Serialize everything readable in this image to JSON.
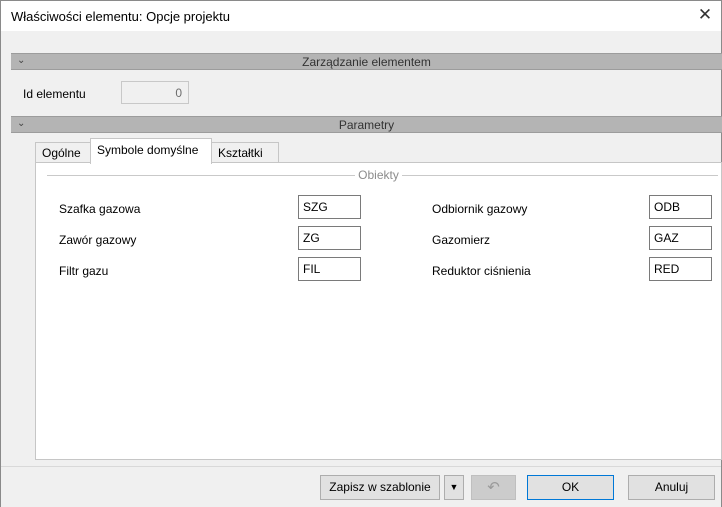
{
  "window": {
    "title": "Właściwości elementu: Opcje projektu",
    "close_glyph": "✕"
  },
  "sections": {
    "management": {
      "label": "Zarządzanie elementem",
      "chevron": "⌄"
    },
    "parameters": {
      "label": "Parametry",
      "chevron": "⌄"
    }
  },
  "element_id": {
    "label": "Id elementu",
    "value": "0"
  },
  "tabs": [
    {
      "label": "Ogólne",
      "active": false
    },
    {
      "label": "Symbole domyślne",
      "active": true
    },
    {
      "label": "Kształtki",
      "active": false
    }
  ],
  "objects_group": {
    "label": "Obiekty",
    "left_fields": [
      {
        "label": "Szafka gazowa",
        "value": "SZG"
      },
      {
        "label": "Zawór gazowy",
        "value": "ZG"
      },
      {
        "label": "Filtr gazu",
        "value": "FIL"
      }
    ],
    "right_fields": [
      {
        "label": "Odbiornik gazowy",
        "value": "ODB"
      },
      {
        "label": "Gazomierz",
        "value": "GAZ"
      },
      {
        "label": "Reduktor ciśnienia",
        "value": "RED"
      }
    ]
  },
  "buttons": {
    "save_template": "Zapisz w szablonie",
    "dropdown_glyph": "▼",
    "undo_glyph": "↶",
    "ok": "OK",
    "cancel": "Anuluj"
  }
}
